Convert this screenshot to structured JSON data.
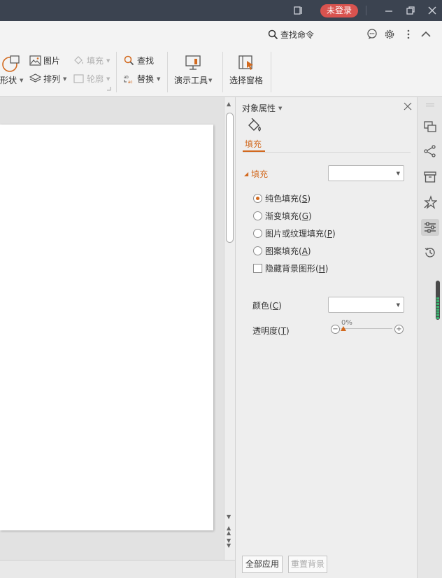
{
  "titlebar": {
    "login_label": "未登录"
  },
  "searchbar": {
    "search_label": "查找命令"
  },
  "ribbon": {
    "shape_label": "形状",
    "picture_label": "图片",
    "fill_label": "填充",
    "arrange_label": "排列",
    "outline_label": "轮廓",
    "find_label": "查找",
    "replace_label": "替换",
    "presentation_tools_label": "演示工具",
    "selection_pane_label": "选择窗格"
  },
  "panel": {
    "title": "对象属性",
    "tab_fill": "填充",
    "section_fill": "填充",
    "options": [
      {
        "label": "纯色填充(",
        "key": "S",
        "checked": true
      },
      {
        "label": "渐变填充(",
        "key": "G",
        "checked": false
      },
      {
        "label": "图片或纹理填充(",
        "key": "P",
        "checked": false
      },
      {
        "label": "图案填充(",
        "key": "A",
        "checked": false
      }
    ],
    "hide_bg_label": "隐藏背景图形(",
    "hide_bg_key": "H",
    "color_label": "颜色(",
    "color_key": "C",
    "transparency_label": "透明度(",
    "transparency_key": "T",
    "transparency_value": "0%",
    "apply_all_label": "全部应用",
    "reset_bg_label": "重置背景"
  },
  "colors": {
    "accent": "#d2691e",
    "login_bg": "#d9534f",
    "titlebar_bg": "#3b4350"
  }
}
